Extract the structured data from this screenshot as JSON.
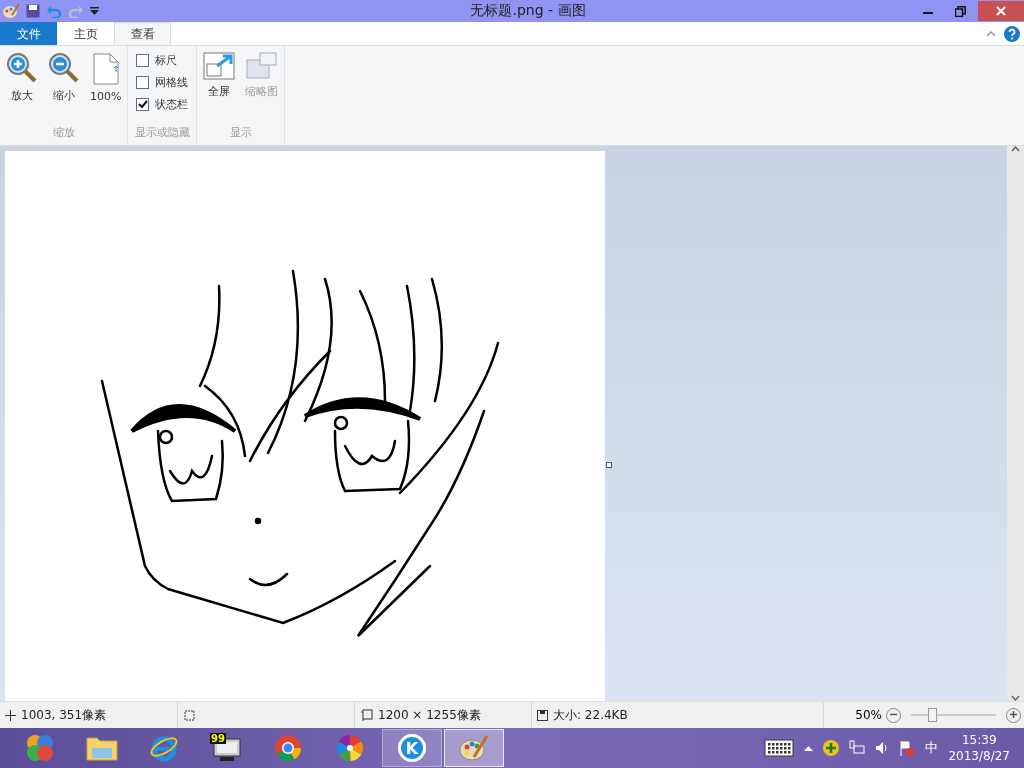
{
  "window": {
    "title": "无标题.png - 画图"
  },
  "tabs": [
    {
      "label": "文件",
      "kind": "file",
      "selected": false
    },
    {
      "label": "主页",
      "kind": "tab",
      "selected": false
    },
    {
      "label": "查看",
      "kind": "tab",
      "selected": true
    }
  ],
  "ribbon": {
    "groups": [
      {
        "label": "缩放",
        "kind": "buttons",
        "items": [
          {
            "label": "放大",
            "disabled": false
          },
          {
            "label": "缩小",
            "disabled": false
          },
          {
            "label": "100%",
            "disabled": false
          }
        ]
      },
      {
        "label": "显示或隐藏",
        "kind": "checks",
        "items": [
          {
            "label": "标尺",
            "checked": false
          },
          {
            "label": "网格线",
            "checked": false
          },
          {
            "label": "状态栏",
            "checked": true
          }
        ]
      },
      {
        "label": "显示",
        "kind": "buttons",
        "items": [
          {
            "label": "全屏",
            "disabled": false
          },
          {
            "label": "缩略图",
            "disabled": true
          }
        ]
      }
    ]
  },
  "status_bar": {
    "cursor": "1003, 351像素",
    "image_size": "1200 × 1255像素",
    "file_size": "大小: 22.4KB",
    "zoom": "50%",
    "zoom_level": {
      "level": 0.26
    }
  },
  "taskbar": {
    "apps": [
      {
        "selected": false,
        "open": false
      },
      {
        "selected": false,
        "open": false
      },
      {
        "selected": false,
        "open": false
      },
      {
        "selected": false,
        "open": false
      },
      {
        "selected": false,
        "open": false
      },
      {
        "selected": false,
        "open": false
      },
      {
        "selected": false,
        "open": true
      },
      {
        "selected": true,
        "open": true
      }
    ],
    "monitor_badge": "99",
    "k_letter": "K",
    "ime": "中",
    "time": "15:39",
    "date": "2013/8/27"
  }
}
